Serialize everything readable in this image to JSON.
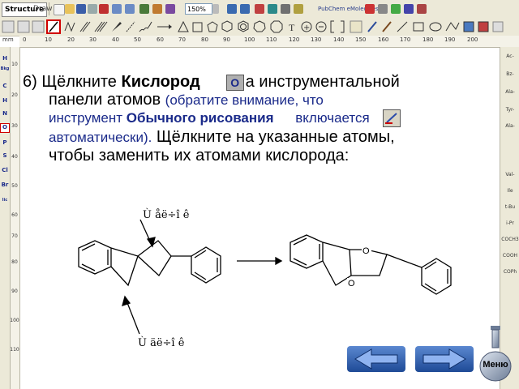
{
  "toolbar": {
    "tab_structure": "Structure",
    "tab_draw": "Draw",
    "zoom": "150%",
    "pubchem": "PubChem eMolecules"
  },
  "ruler": {
    "unit": "mm",
    "h_labels": [
      "0",
      "10",
      "20",
      "30",
      "40",
      "50",
      "60",
      "70",
      "80",
      "90",
      "100",
      "110",
      "120",
      "130",
      "140",
      "150",
      "160",
      "170",
      "180",
      "190",
      "200"
    ],
    "v_labels": [
      "10",
      "20",
      "30",
      "40",
      "50",
      "60",
      "70",
      "80",
      "90",
      "100",
      "110"
    ]
  },
  "atom_panel": {
    "items": [
      "H",
      "Bkg",
      "C",
      "H",
      "N",
      "O",
      "P",
      "S",
      "Cl",
      "Br",
      "lic"
    ],
    "selected": "O"
  },
  "right_panel": {
    "items": [
      "Ac-",
      "Bz-",
      "Ala-",
      "Tyr-",
      "Ala-",
      "Val-",
      "Ile",
      "t-Bu",
      "i-Pr",
      "COCH3",
      "COOH",
      "COPh"
    ]
  },
  "instruction": {
    "number": "6)",
    "part1": "Щёлкните",
    "oxygen": "Кислород",
    "part2": "а инструментальной",
    "line2a": "панели атомов",
    "note1": "(обратите внимание, что",
    "note2_pre": "инструмент",
    "normal_draw": "Обычного рисования",
    "note2_post": "включается",
    "note3": "автоматически).",
    "part3": "Щёлкните на указанные атомы,",
    "part4": "чтобы заменить их атомами кислорода:"
  },
  "o_button": "O",
  "labels": {
    "top": "Ù åë÷î ê",
    "bottom": "Ù äë÷î ê"
  },
  "nav": {
    "back_color": "#2a5aa8",
    "forward_color": "#2a5aa8",
    "menu": "Меню"
  },
  "colors": {
    "toolbar": "#ece9d8",
    "accent_red": "#d00000",
    "note_blue": "#1a2a8a"
  }
}
